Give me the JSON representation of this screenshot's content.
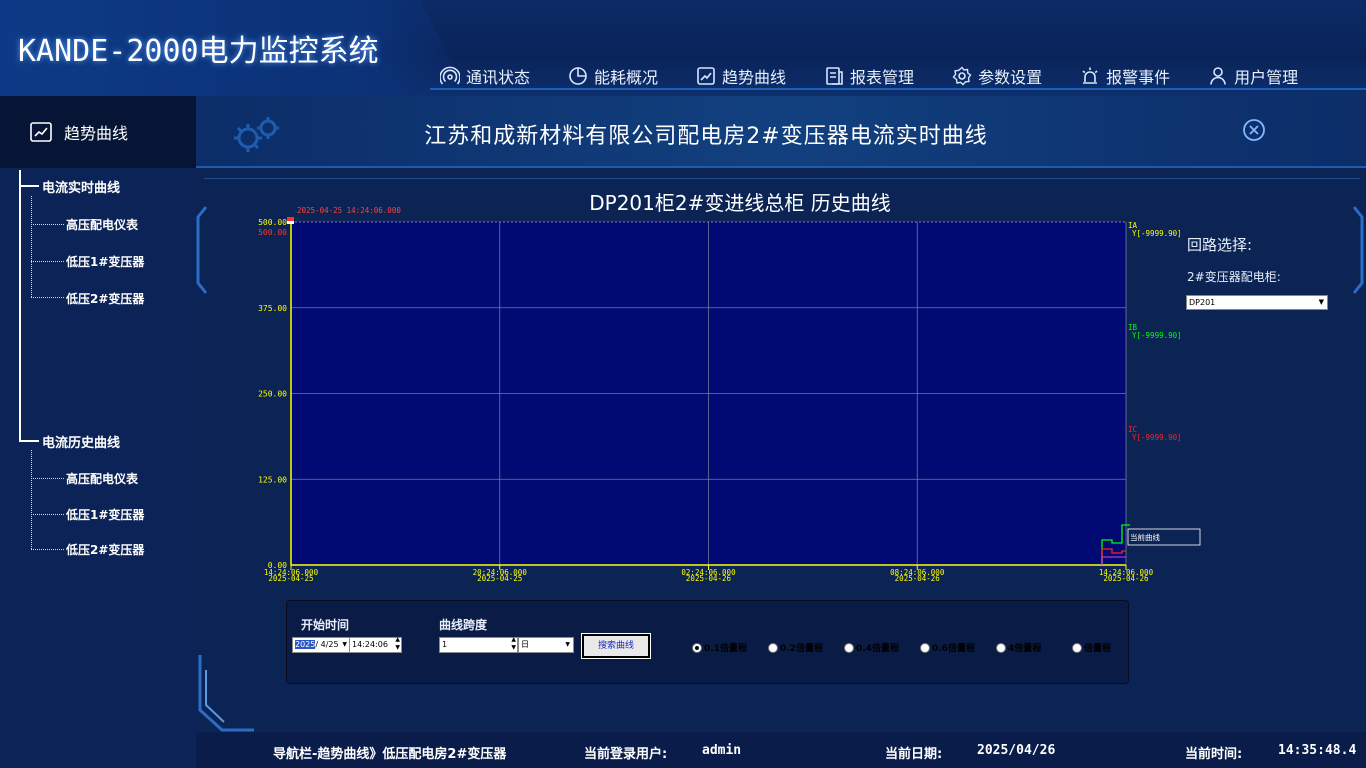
{
  "app": {
    "title": "KANDE-2000电力监控系统"
  },
  "nav": {
    "items": [
      {
        "label": "通讯状态",
        "icon": "signal-icon"
      },
      {
        "label": "能耗概况",
        "icon": "pie-chart-icon"
      },
      {
        "label": "趋势曲线",
        "icon": "trend-chart-icon"
      },
      {
        "label": "报表管理",
        "icon": "report-icon"
      },
      {
        "label": "参数设置",
        "icon": "gear-icon"
      },
      {
        "label": "报警事件",
        "icon": "alarm-icon"
      },
      {
        "label": "用户管理",
        "icon": "user-icon"
      }
    ]
  },
  "sidebar": {
    "header": "趋势曲线",
    "groups": [
      {
        "label": "电流实时曲线",
        "items": [
          "高压配电仪表",
          "低压1#变压器",
          "低压2#变压器"
        ]
      },
      {
        "label": "电流历史曲线",
        "items": [
          "高压配电仪表",
          "低压1#变压器",
          "低压2#变压器"
        ]
      }
    ]
  },
  "page": {
    "title": "江苏和成新材料有限公司配电房2#变压器电流实时曲线"
  },
  "chart_data": {
    "type": "line",
    "title": "DP201柜2#变进线总柜 历史曲线",
    "ylim": [
      0,
      500
    ],
    "y_ticks": [
      "0.00",
      "125.00",
      "250.00",
      "375.00",
      "500.00"
    ],
    "y_top_red": "500.00",
    "cursor_time": "2025-04-25 14:24:06.000",
    "x_ticks": [
      {
        "time": "14:24:06.000",
        "date": "2025-04-25"
      },
      {
        "time": "20:24:06.000",
        "date": "2025-04-25"
      },
      {
        "time": "02:24:06.000",
        "date": "2025-04-26"
      },
      {
        "time": "08:24:06.000",
        "date": "2025-04-26"
      },
      {
        "time": "14:24:06.000",
        "date": "2025-04-26"
      }
    ],
    "series": [
      {
        "name": "IA",
        "value_label": "Y[-9999.90]",
        "color": "#ffff00"
      },
      {
        "name": "IB",
        "value_label": "Y[-9999.90]",
        "color": "#00ff00"
      },
      {
        "name": "IC",
        "value_label": "Y[-9999.90]",
        "color": "#ff2020"
      }
    ],
    "legend_box": "当前曲线"
  },
  "side": {
    "loop_label": "回路选择:",
    "cabinet_label": "2#变压器配电柜:",
    "cabinet_value": "DP201"
  },
  "controls": {
    "start_label": "开始时间",
    "span_label": "曲线跨度",
    "start_year": "2025",
    "start_date": "/ 4/25",
    "start_time": "14:24:06",
    "span_value": "1",
    "span_unit": "日",
    "search_label": "搜索曲线",
    "radios": [
      {
        "label": "0.1倍量程",
        "checked": true
      },
      {
        "label": "0.2倍量程",
        "checked": false
      },
      {
        "label": "0.4倍量程",
        "checked": false
      },
      {
        "label": "0.6倍量程",
        "checked": false
      },
      {
        "label": "4倍量程",
        "checked": false
      },
      {
        "label": "倍量程",
        "checked": false
      }
    ]
  },
  "status": {
    "nav_path": "导航栏-趋势曲线》低压配电房2#变压器",
    "user_label": "当前登录用户:",
    "user_value": "admin",
    "date_label": "当前日期:",
    "date_value": "2025/04/26",
    "time_label": "当前时间:",
    "time_value": "14:35:48.4"
  }
}
